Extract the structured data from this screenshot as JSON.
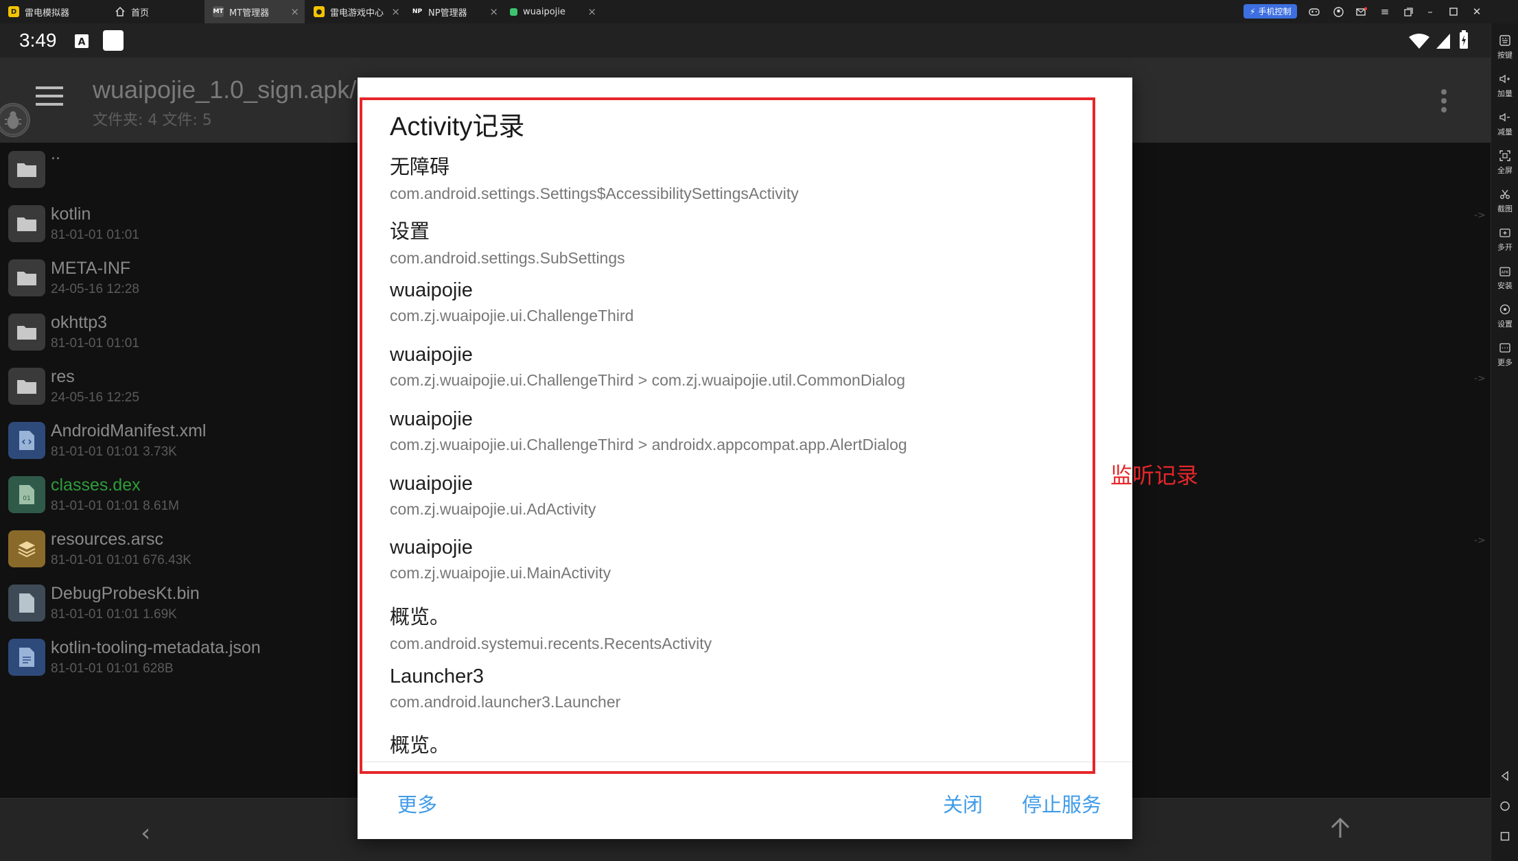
{
  "tabs": [
    {
      "label": "雷电模拟器",
      "icon": "ldplayer-logo-icon"
    },
    {
      "label": "首页",
      "icon": "home-icon"
    },
    {
      "label": "MT管理器",
      "icon": "mt-manager-icon",
      "active": true
    },
    {
      "label": "雷电游戏中心",
      "icon": "game-center-icon"
    },
    {
      "label": "NP管理器",
      "icon": "np-manager-icon"
    },
    {
      "label": "wuaipojie",
      "icon": "app-icon"
    }
  ],
  "window_controls": {
    "phone_control_label": "手机控制"
  },
  "sidebar": {
    "items": [
      {
        "label": "按键",
        "icon": "keyboard-icon"
      },
      {
        "label": "加量",
        "icon": "volume-up-icon"
      },
      {
        "label": "减量",
        "icon": "volume-down-icon"
      },
      {
        "label": "全屏",
        "icon": "fullscreen-icon"
      },
      {
        "label": "截图",
        "icon": "scissors-icon"
      },
      {
        "label": "多开",
        "icon": "multi-instance-icon"
      },
      {
        "label": "安装",
        "icon": "apk-install-icon"
      },
      {
        "label": "设置",
        "icon": "settings-icon"
      },
      {
        "label": "更多",
        "icon": "more-icon"
      }
    ]
  },
  "status_bar": {
    "time": "3:49"
  },
  "app_header": {
    "title": "wuaipojie_1.0_sign.apk/",
    "subtitle": "文件夹: 4  文件: 5"
  },
  "files": [
    {
      "name": "..",
      "meta": "",
      "type": "folder"
    },
    {
      "name": "kotlin",
      "meta": "81-01-01 01:01",
      "type": "folder"
    },
    {
      "name": "META-INF",
      "meta": "24-05-16 12:28",
      "type": "folder"
    },
    {
      "name": "okhttp3",
      "meta": "81-01-01 01:01",
      "type": "folder"
    },
    {
      "name": "res",
      "meta": "24-05-16 12:25",
      "type": "folder"
    },
    {
      "name": "AndroidManifest.xml",
      "meta": "81-01-01 01:01  3.73K",
      "type": "xml"
    },
    {
      "name": "classes.dex",
      "meta": "81-01-01 01:01  8.61M",
      "type": "dex"
    },
    {
      "name": "resources.arsc",
      "meta": "81-01-01 01:01  676.43K",
      "type": "arsc"
    },
    {
      "name": "DebugProbesKt.bin",
      "meta": "81-01-01 01:01  1.69K",
      "type": "bin"
    },
    {
      "name": "kotlin-tooling-metadata.json",
      "meta": "81-01-01 01:01  628B",
      "type": "json"
    }
  ],
  "dialog": {
    "title": "Activity记录",
    "items": [
      {
        "name": "无障碍",
        "class": "com.android.settings.Settings$AccessibilitySettingsActivity"
      },
      {
        "name": "设置",
        "class": "com.android.settings.SubSettings"
      },
      {
        "name": "wuaipojie",
        "class": "com.zj.wuaipojie.ui.ChallengeThird"
      },
      {
        "name": "wuaipojie",
        "class": "com.zj.wuaipojie.ui.ChallengeThird > com.zj.wuaipojie.util.CommonDialog"
      },
      {
        "name": "wuaipojie",
        "class": "com.zj.wuaipojie.ui.ChallengeThird > androidx.appcompat.app.AlertDialog"
      },
      {
        "name": "wuaipojie",
        "class": "com.zj.wuaipojie.ui.AdActivity"
      },
      {
        "name": "wuaipojie",
        "class": "com.zj.wuaipojie.ui.MainActivity"
      },
      {
        "name": "概览。",
        "class": "com.android.systemui.recents.RecentsActivity"
      },
      {
        "name": "Launcher3",
        "class": "com.android.launcher3.Launcher"
      },
      {
        "name": "概览。",
        "class": ""
      }
    ],
    "buttons": {
      "more": "更多",
      "close": "关闭",
      "stop_service": "停止服务"
    }
  },
  "annotation": {
    "label": "监听记录",
    "color": "#e5262a"
  },
  "colors": {
    "accent": "#3f9be8",
    "dex_green": "#2e9e3a",
    "folder": "#3a3a3a"
  }
}
